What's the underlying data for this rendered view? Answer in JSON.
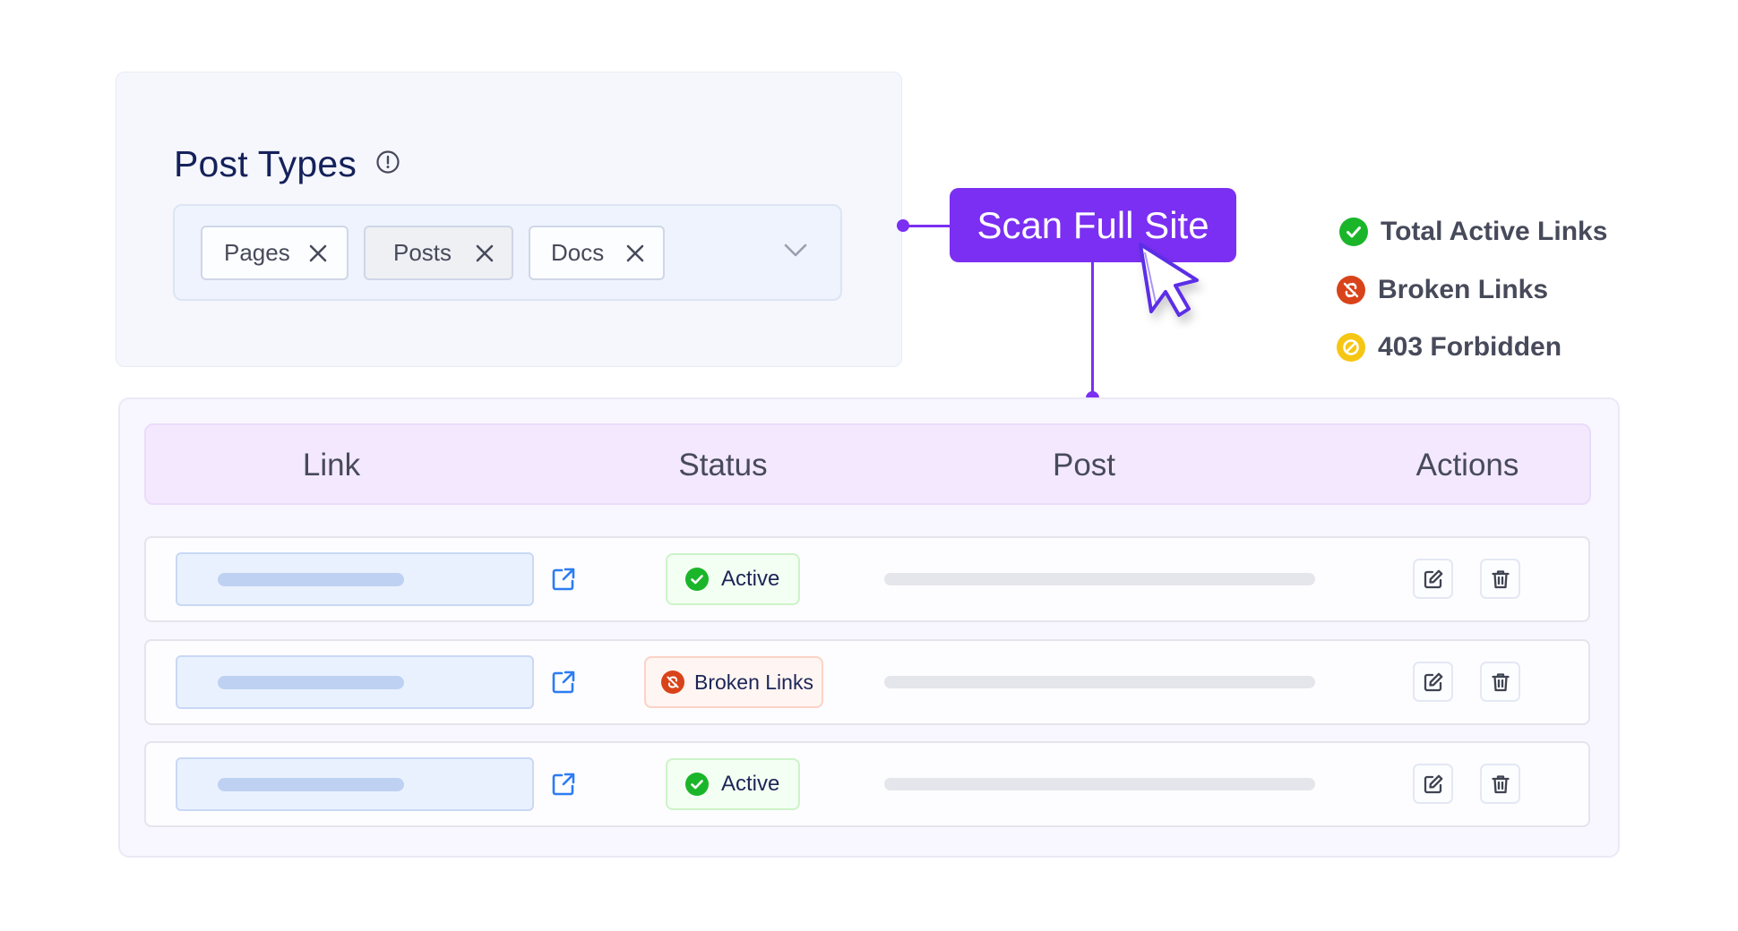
{
  "post_types": {
    "title": "Post Types",
    "info_icon": "info-circle-icon",
    "chips": [
      {
        "label": "Pages",
        "selected": false
      },
      {
        "label": "Posts",
        "selected": true
      },
      {
        "label": "Docs",
        "selected": false
      }
    ],
    "dropdown_icon": "chevron-down-icon"
  },
  "scan_button": {
    "label": "Scan Full Site",
    "color": "#7b2ff2"
  },
  "legend": [
    {
      "label": "Total Active Links",
      "icon": "check-circle-icon",
      "color": "#1bb52a"
    },
    {
      "label": "Broken Links",
      "icon": "broken-link-icon",
      "color": "#d9431a"
    },
    {
      "label": "403 Forbidden",
      "icon": "forbidden-icon",
      "color": "#f6c614"
    }
  ],
  "table": {
    "columns": [
      "Link",
      "Status",
      "Post",
      "Actions"
    ],
    "rows": [
      {
        "status": "Active",
        "status_type": "active"
      },
      {
        "status": "Broken Links",
        "status_type": "broken"
      },
      {
        "status": "Active",
        "status_type": "active"
      }
    ]
  }
}
